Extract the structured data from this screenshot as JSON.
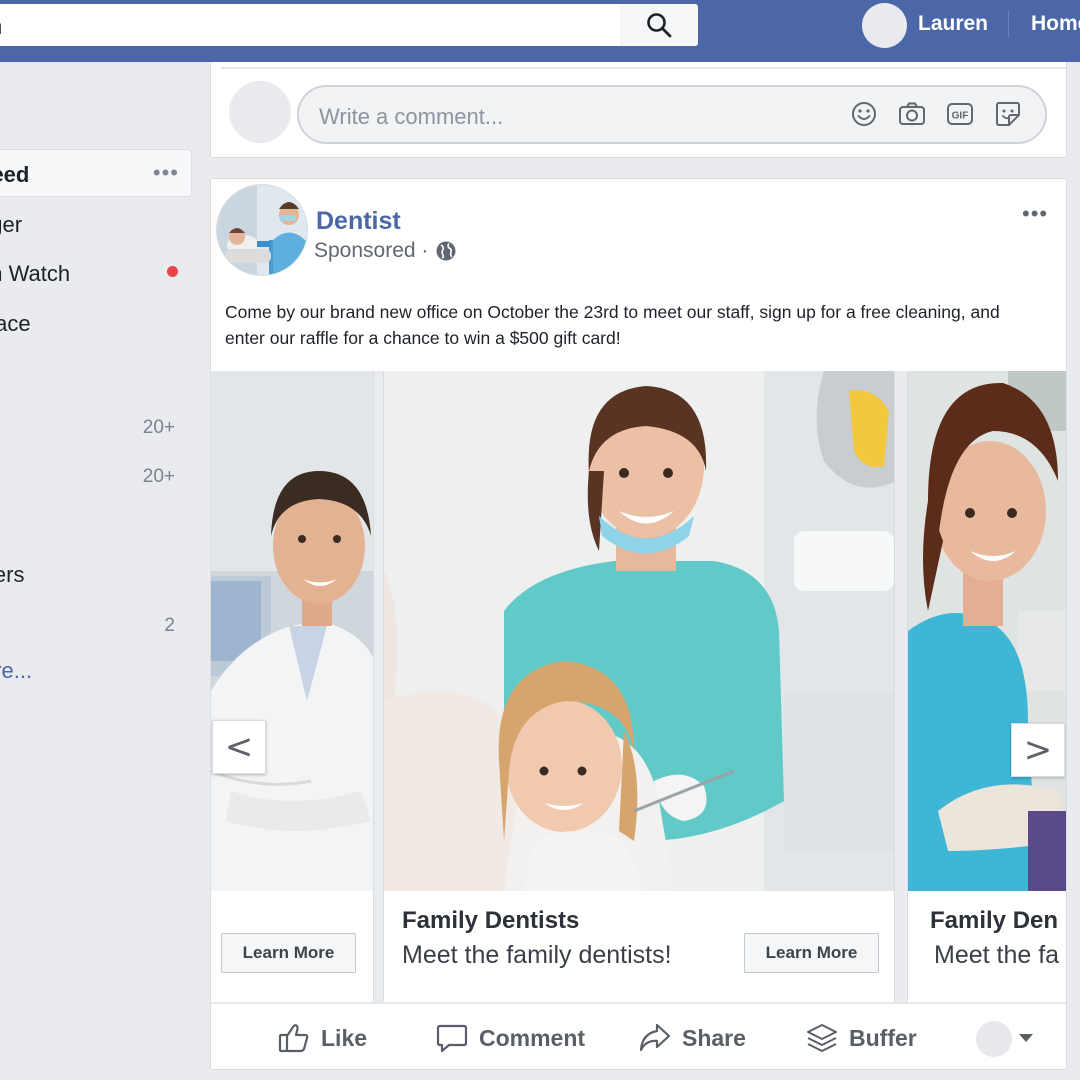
{
  "topbar": {
    "search_text": "ch",
    "user_name": "Lauren",
    "home_label": "Home"
  },
  "sidebar": {
    "items": [
      {
        "label": "Feed",
        "active": true
      },
      {
        "label": "nger"
      },
      {
        "label": "on Watch",
        "notification_dot": true
      },
      {
        "label": "place"
      },
      {
        "label": "",
        "count": "20+"
      },
      {
        "label": "",
        "count": "20+"
      },
      {
        "label": "isers"
      },
      {
        "label": "",
        "count": "2"
      }
    ],
    "more_link": "ore..."
  },
  "comment_box": {
    "placeholder": "Write a comment...",
    "icons": [
      "emoji-icon",
      "camera-icon",
      "gif-icon",
      "sticker-icon"
    ]
  },
  "ad_post": {
    "page_name": "Dentist",
    "sponsored_label": "Sponsored ·",
    "body": "Come by our brand new office on October the 23rd to meet our staff, sign up for a free cleaning, and enter our raffle for a chance to win a $500 gift card!",
    "carousel": [
      {
        "title": "",
        "subtitle": "",
        "button": "Learn More"
      },
      {
        "title": "Family Dentists",
        "subtitle": "Meet the family dentists!",
        "button": "Learn More"
      },
      {
        "title": "Family Den",
        "subtitle": "Meet the fa",
        "button": ""
      }
    ],
    "prev_arrow": "<",
    "next_arrow": ">",
    "actions": {
      "like": "Like",
      "comment": "Comment",
      "share": "Share",
      "buffer": "Buffer"
    }
  },
  "colors": {
    "brand_blue": "#4b67a8",
    "notification_red": "#e9434b",
    "scrub_teal": "#62c9c9"
  }
}
